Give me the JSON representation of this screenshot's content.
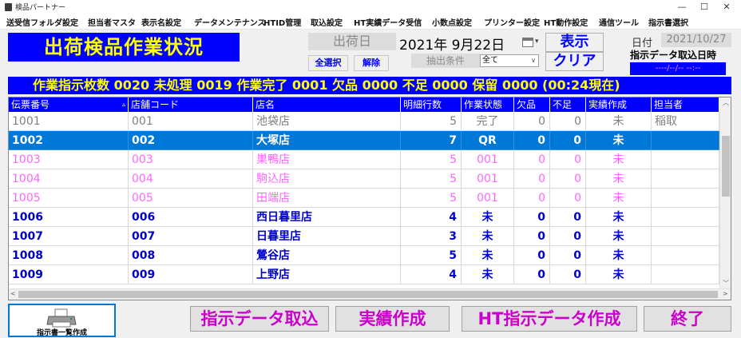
{
  "window": {
    "title": "検品パートナー",
    "controls": {
      "minimize": "—",
      "maximize": "☐",
      "close": "✕"
    }
  },
  "menu": [
    "送受信フォルダ設定",
    "担当者マスタ",
    "表示名設定",
    "データメンテナンス",
    "HTID管理",
    "取込設定",
    "HT実績データ受信",
    "小数点設定",
    "プリンター設定",
    "HT動作設定",
    "通信ツール",
    "指示書選択"
  ],
  "header": {
    "title": "出荷検品作業状況",
    "ship_date_label": "出荷日",
    "ship_date_value": "2021年  9月22日",
    "select_all": "全選択",
    "clear_selection": "解除",
    "filter_label": "抽出条件",
    "filter_value": "全て",
    "display_button": "表示",
    "clear_button": "クリア",
    "date_label": "日付",
    "date_value": "2021/10/27",
    "import_datetime_label": "指示データ取込日時",
    "import_datetime_value": "----/--/-- --:--"
  },
  "status_text": "作業指示枚数 0020  未処理 0019  作業完了 0001  欠品 0000  不足 0000  保留 0000  (00:24現在)",
  "table": {
    "columns": [
      "伝票番号",
      "店舗コード",
      "店名",
      "明細行数",
      "作業状態",
      "欠品",
      "不足",
      "実績作成",
      "担当者"
    ],
    "sort_indicator": "▵",
    "rows": [
      [
        "1001",
        "001",
        "池袋店",
        "5",
        "完了",
        "0",
        "0",
        "未",
        "稲取"
      ],
      [
        "1002",
        "002",
        "大塚店",
        "7",
        "QR",
        "0",
        "0",
        "未",
        ""
      ],
      [
        "1003",
        "003",
        "巣鴨店",
        "5",
        "001",
        "0",
        "0",
        "未",
        ""
      ],
      [
        "1004",
        "004",
        "駒込店",
        "5",
        "001",
        "0",
        "0",
        "未",
        ""
      ],
      [
        "1005",
        "005",
        "田端店",
        "5",
        "001",
        "0",
        "0",
        "未",
        ""
      ],
      [
        "1006",
        "006",
        "西日暮里店",
        "4",
        "未",
        "0",
        "0",
        "未",
        ""
      ],
      [
        "1007",
        "007",
        "日暮里店",
        "3",
        "未",
        "0",
        "0",
        "未",
        ""
      ],
      [
        "1008",
        "008",
        "鶯谷店",
        "5",
        "未",
        "0",
        "0",
        "未",
        ""
      ],
      [
        "1009",
        "009",
        "上野店",
        "4",
        "未",
        "0",
        "0",
        "未",
        ""
      ]
    ],
    "row_states": [
      "complete",
      "selected",
      "pending",
      "pending",
      "pending",
      "todo",
      "todo",
      "todo",
      "todo"
    ]
  },
  "footer": {
    "print_list": "指示書一覧作成",
    "import_instructions": "指示データ取込",
    "create_results": "実績作成",
    "create_ht_data": "HT指示データ作成",
    "exit": "終了"
  },
  "colors": {
    "title_bg": "#0000ff",
    "title_text": "#ffff00",
    "selected_row": "#0078d7",
    "complete_text": "#808080",
    "pending_text": "#ff66ff",
    "todo_text": "#0000cc",
    "footer_button_text": "#cc00cc"
  }
}
